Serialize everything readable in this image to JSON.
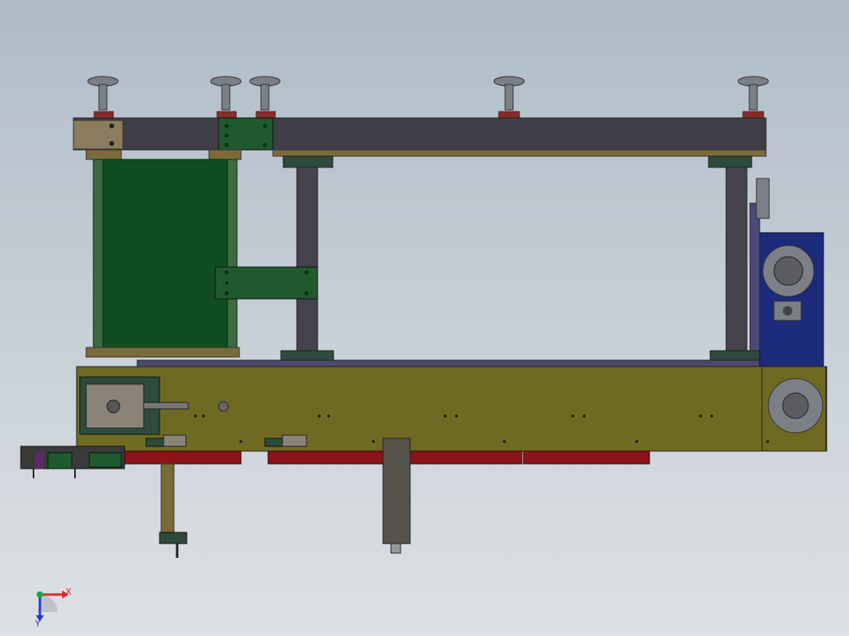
{
  "view": {
    "background_top": "#aebbc7",
    "background_bottom": "#dde1e4"
  },
  "triad": {
    "x_label": "X",
    "y_label": "Y",
    "x_color": "#e0262a",
    "y_color": "#2a35d6",
    "z_color": "#1fa34a"
  },
  "colors": {
    "beam": "#3f3d45",
    "base": "#6e6a22",
    "green_panel": "#0f4d1e",
    "plate_green": "#1f5a2e",
    "motor_blue": "#1c2a7a",
    "red_rail": "#8a1418",
    "tan": "#7a6a3a"
  }
}
